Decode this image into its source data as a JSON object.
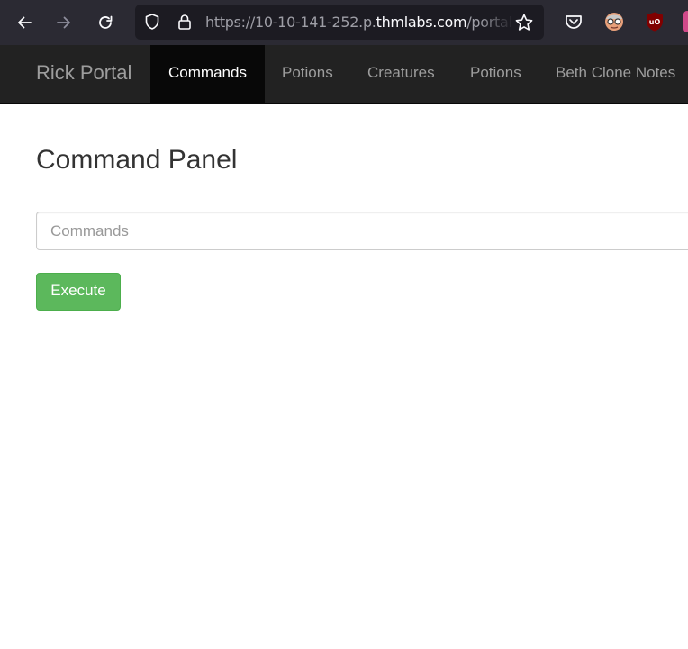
{
  "browser": {
    "url_prefix": "https://10-10-141-252.p.",
    "url_host": "thmlabs.com",
    "url_path": "/portal",
    "icons": [
      "back-icon",
      "forward-icon",
      "reload-icon",
      "shield-icon",
      "lock-icon",
      "bookmark-star-icon",
      "pocket-icon",
      "extension-avatar-icon",
      "ublock-icon"
    ]
  },
  "navbar": {
    "brand": "Rick Portal",
    "items": [
      {
        "label": "Commands",
        "active": true
      },
      {
        "label": "Potions",
        "active": false
      },
      {
        "label": "Creatures",
        "active": false
      },
      {
        "label": "Potions",
        "active": false
      },
      {
        "label": "Beth Clone Notes",
        "active": false
      }
    ]
  },
  "main": {
    "title": "Command Panel",
    "command_input": {
      "value": "",
      "placeholder": "Commands"
    },
    "execute_label": "Execute"
  },
  "colors": {
    "navbar_bg": "#222222",
    "active_tab_bg": "#080808",
    "execute_button": "#5cb85c",
    "browser_chrome": "#2b2a33"
  }
}
